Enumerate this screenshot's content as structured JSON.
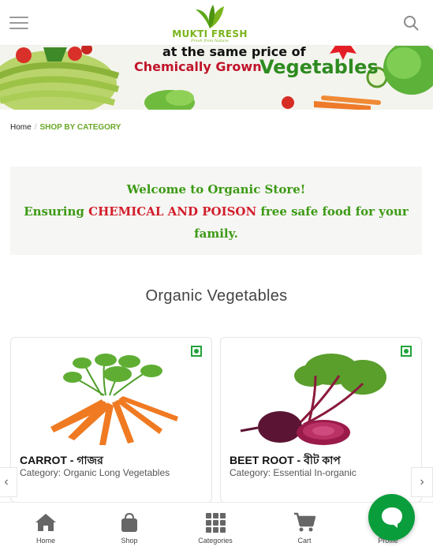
{
  "header": {
    "logo_text": "MUKTI FRESH",
    "logo_tagline": "Fresh from Nature"
  },
  "banner": {
    "line1": "at the same price of",
    "line2_part1": "Chemically Grown",
    "line2_part2": "Vegetables"
  },
  "breadcrumb": {
    "home": "Home",
    "separator": "/",
    "current": "SHOP BY CATEGORY"
  },
  "welcome": {
    "line1": "Welcome to Organic Store!",
    "line2_before": "Ensuring ",
    "line2_highlight": "CHEMICAL AND POISON",
    "line2_after": " free safe food for your",
    "line3": "family."
  },
  "section": {
    "title": "Organic Vegetables"
  },
  "products": [
    {
      "name": "CARROT - গাজর",
      "category": "Category: Organic Long Vegetables",
      "image_icon": "carrot-image"
    },
    {
      "name": "BEET ROOT - বীট কাপ",
      "category": "Category: Essential In-organic",
      "image_icon": "beetroot-image"
    }
  ],
  "carousel": {
    "prev": "‹",
    "next": "›"
  },
  "bottom_nav": [
    {
      "label": "Home",
      "icon": "home-icon"
    },
    {
      "label": "Shop",
      "icon": "bag-icon"
    },
    {
      "label": "Categories",
      "icon": "grid-icon"
    },
    {
      "label": "Cart",
      "icon": "cart-icon"
    },
    {
      "label": "Profile",
      "icon": "user-icon"
    }
  ],
  "colors": {
    "brand_green": "#7ab51d",
    "welcome_green": "#3c9a14",
    "alert_red": "#d21e2b",
    "chat_green": "#0a9d3c"
  }
}
